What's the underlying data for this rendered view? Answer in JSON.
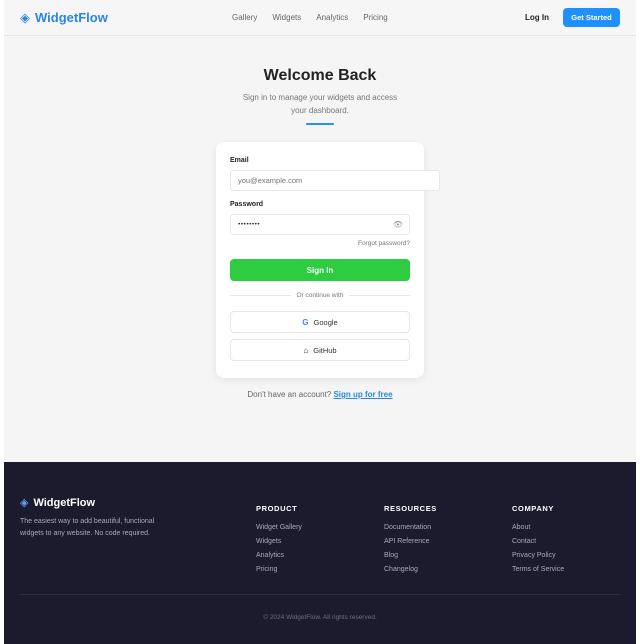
{
  "header": {
    "brand": "WidgetFlow",
    "nav": [
      "Gallery",
      "Widgets",
      "Analytics",
      "Pricing"
    ],
    "login_label": "Log In",
    "cta_label": "Get Started"
  },
  "hero": {
    "title": "Welcome Back",
    "subtitle": "Sign in to manage your widgets and access your dashboard."
  },
  "form": {
    "email_label": "Email",
    "email_placeholder": "you@example.com",
    "password_label": "Password",
    "password_value": "••••••••",
    "forgot_label": "Forgot password?",
    "signin_label": "Sign In",
    "divider_text": "Or continue with",
    "google_label": "Google",
    "github_label": "GitHub"
  },
  "signup": {
    "prompt": "Don't have an account?",
    "link": "Sign up for free"
  },
  "footer": {
    "brand": "WidgetFlow",
    "description": "The easiest way to add beautiful, functional widgets to any website. No code required.",
    "columns": [
      {
        "title": "PRODUCT",
        "links": [
          "Widget Gallery",
          "Widgets",
          "Analytics",
          "Pricing"
        ]
      },
      {
        "title": "RESOURCES",
        "links": [
          "Documentation",
          "API Reference",
          "Blog",
          "Changelog"
        ]
      },
      {
        "title": "COMPANY",
        "links": [
          "About",
          "Contact",
          "Privacy Policy",
          "Terms of Service"
        ]
      }
    ],
    "copyright": "© 2024 WidgetFlow. All rights reserved."
  },
  "colors": {
    "brand": "#2a86e8",
    "cta": "#1e90ff",
    "signin": "#2ecc40",
    "footer_bg": "#1c1b2e"
  },
  "icons": {
    "logo": "diamond-icon",
    "password_toggle": "eye-icon",
    "google": "google-icon",
    "github": "github-icon"
  }
}
